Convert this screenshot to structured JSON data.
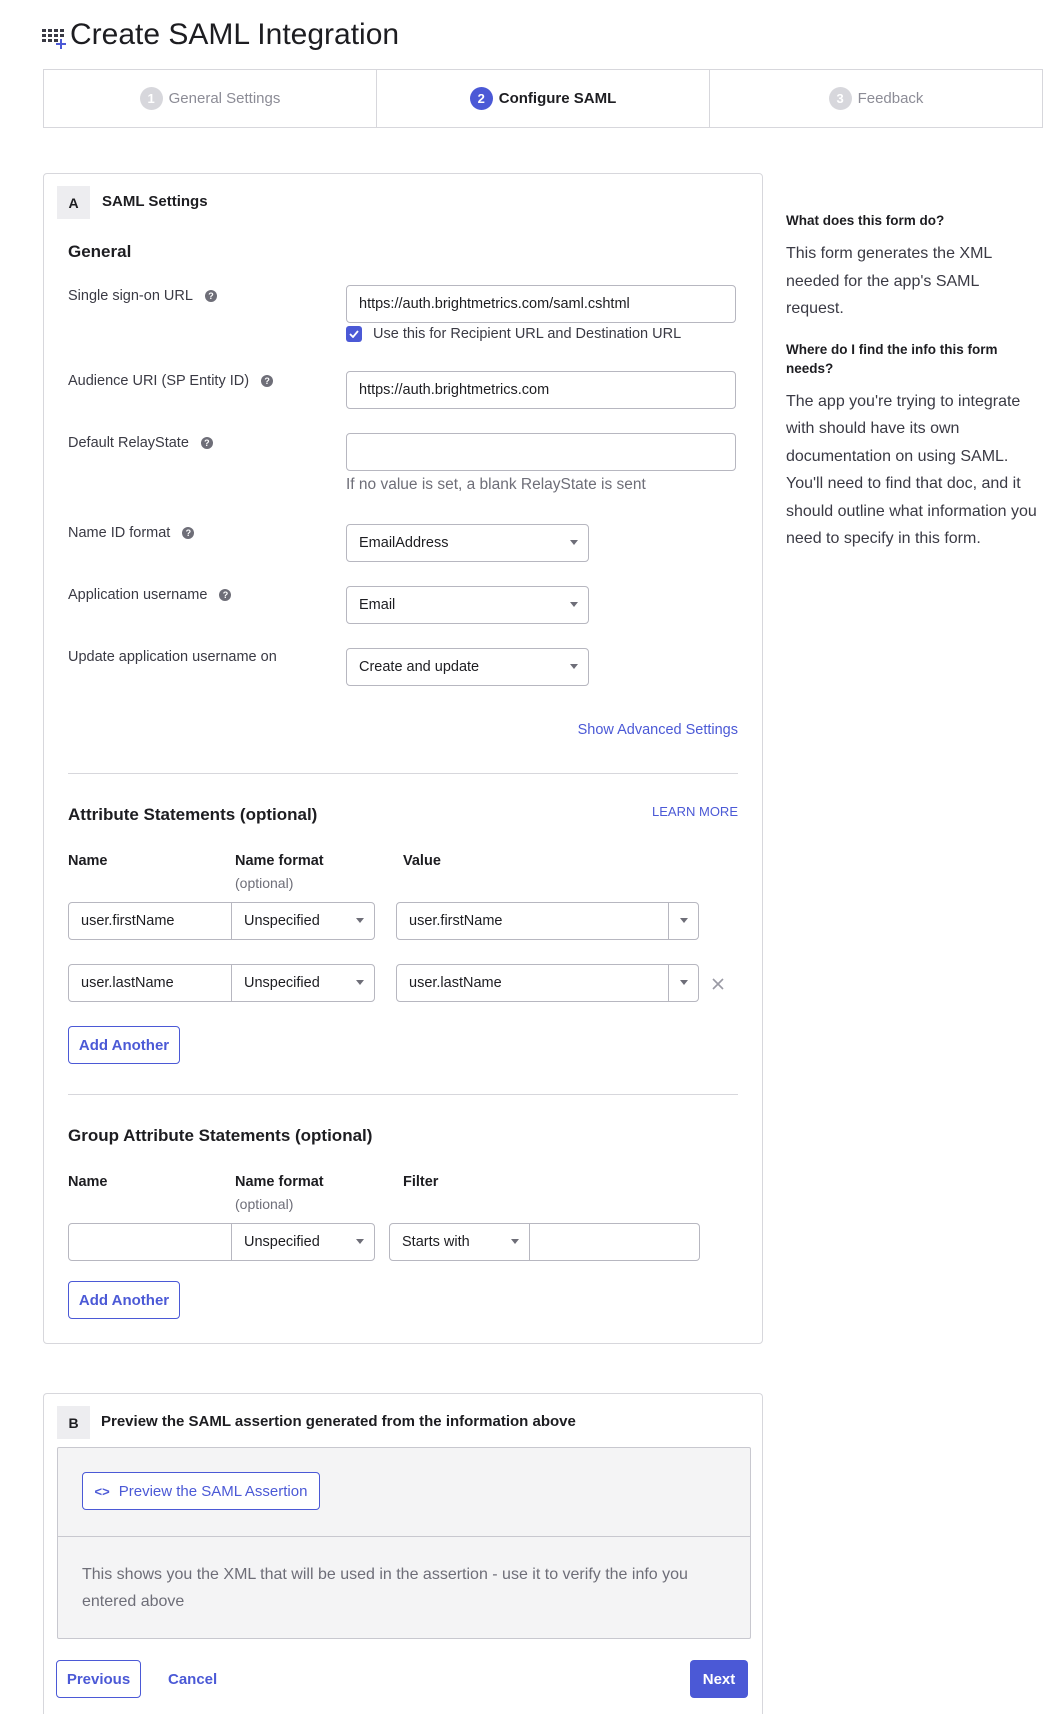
{
  "page": {
    "title": "Create SAML Integration",
    "title_icon": "apps-add-icon"
  },
  "stepper": [
    {
      "num": "1",
      "label": "General Settings",
      "active": false
    },
    {
      "num": "2",
      "label": "Configure SAML",
      "active": true
    },
    {
      "num": "3",
      "label": "Feedback",
      "active": false
    }
  ],
  "section_a": {
    "badge": "A",
    "title": "SAML Settings",
    "general": {
      "heading": "General",
      "sso_url": {
        "label": "Single sign-on URL",
        "value": "https://auth.brightmetrics.com/saml.cshtml"
      },
      "recipient_checkbox": {
        "label": "Use this for Recipient URL and Destination URL",
        "checked": true
      },
      "audience_uri": {
        "label": "Audience URI (SP Entity ID)",
        "value": "https://auth.brightmetrics.com"
      },
      "relay_state": {
        "label": "Default RelayState",
        "value": "",
        "hint": "If no value is set, a blank RelayState is sent"
      },
      "name_id_format": {
        "label": "Name ID format",
        "value": "EmailAddress"
      },
      "app_username": {
        "label": "Application username",
        "value": "Email"
      },
      "update_username_on": {
        "label": "Update application username on",
        "value": "Create and update"
      },
      "advanced_link": "Show Advanced Settings"
    },
    "attributes": {
      "heading": "Attribute Statements (optional)",
      "learn_more": "LEARN MORE",
      "col_name": "Name",
      "col_format": "Name format",
      "col_format_sub": "(optional)",
      "col_value": "Value",
      "rows": [
        {
          "name": "user.firstName",
          "format": "Unspecified",
          "value": "user.firstName"
        },
        {
          "name": "user.lastName",
          "format": "Unspecified",
          "value": "user.lastName"
        }
      ],
      "add_button": "Add Another"
    },
    "group_attributes": {
      "heading": "Group Attribute Statements (optional)",
      "col_name": "Name",
      "col_format": "Name format",
      "col_format_sub": "(optional)",
      "col_filter": "Filter",
      "row": {
        "name": "",
        "format": "Unspecified",
        "filter_type": "Starts with",
        "filter_value": ""
      },
      "add_button": "Add Another"
    }
  },
  "section_b": {
    "badge": "B",
    "title": "Preview the SAML assertion generated from the information above",
    "preview_button": "Preview the SAML Assertion",
    "description": "This shows you the XML that will be used in the assertion - use it to verify the info you entered above"
  },
  "footer": {
    "previous": "Previous",
    "cancel": "Cancel",
    "next": "Next"
  },
  "sidebar": {
    "q1": "What does this form do?",
    "a1": "This form generates the XML needed for the app's SAML request.",
    "q2": "Where do I find the info this form needs?",
    "a2": "The app you're trying to integrate with should have its own documentation on using SAML. You'll need to find that doc, and it should outline what information you need to specify in this form."
  }
}
